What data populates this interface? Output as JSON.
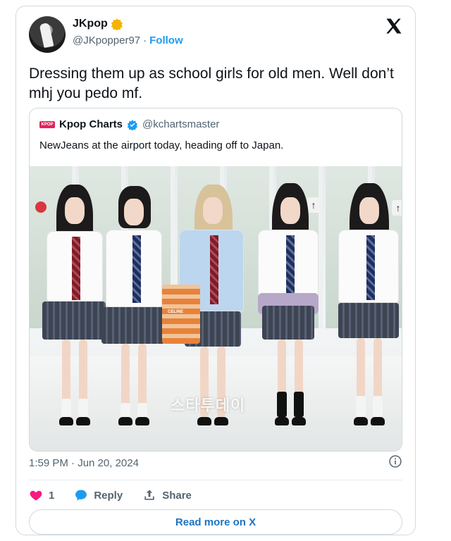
{
  "author": {
    "name": "JKpop",
    "handle": "@JKpopper97",
    "separator": "·",
    "follow_label": "Follow",
    "verified_badge": "gold-star-badge"
  },
  "tweet": {
    "text": "Dressing them up as school girls for old men. Well don’t mhj you pedo mf."
  },
  "quote": {
    "logo_text": "KPOP",
    "name": "Kpop Charts",
    "handle": "@kchartsmaster",
    "text": "NewJeans at the airport today, heading off to Japan.",
    "photo_watermark": "스타투데이",
    "bag_label": "CELINE"
  },
  "meta": {
    "timestamp": "1:59 PM · Jun 20, 2024"
  },
  "actions": {
    "like_count": "1",
    "reply_label": "Reply",
    "share_label": "Share"
  },
  "read_more_label": "Read more on X",
  "colors": {
    "accent": "#1d9bf0",
    "link": "#1d74c4",
    "like": "#f91880",
    "text": "#0f1419",
    "muted": "#536471"
  }
}
